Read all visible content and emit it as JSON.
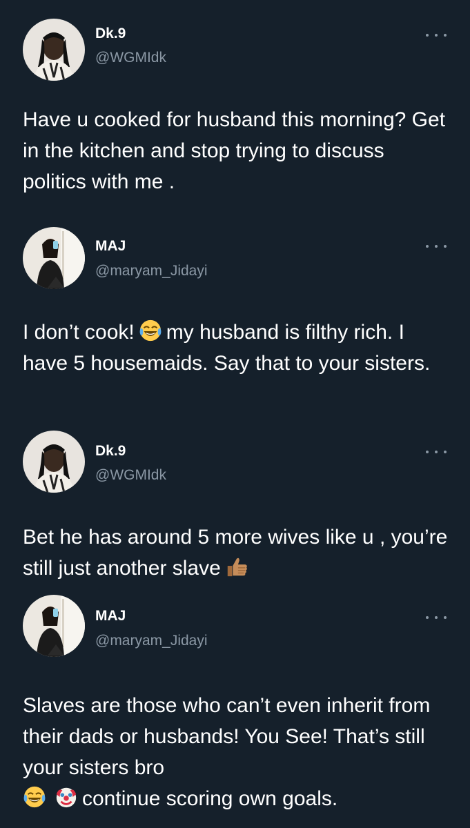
{
  "tweets": [
    {
      "name": "Dk.9",
      "handle": "@WGMIdk",
      "text": "Have u cooked for husband this morning? Get in the kitchen and stop trying to discuss politics with me ."
    },
    {
      "name": "MAJ",
      "handle": "@maryam_Jidayi",
      "text_part1": "I don’t cook!",
      "emoji1": "face-with-tears-of-joy-emoji",
      "text_part2": "my husband is filthy rich. I have 5 housemaids. Say that to your sisters."
    },
    {
      "name": "Dk.9",
      "handle": "@WGMIdk",
      "text": "Bet he has around 5 more wives like u , you’re still just another slave",
      "emoji1": "thumbs-up-emoji"
    },
    {
      "name": "MAJ",
      "handle": "@maryam_Jidayi",
      "text": "Slaves are those who can’t even inherit from their dads or husbands! You See! That’s still your sisters bro",
      "emoji1": "face-with-tears-of-joy-emoji",
      "emoji2": "clown-face-emoji",
      "text_end": "continue scoring own goals."
    }
  ],
  "colors": {
    "background": "#15202b",
    "text": "#ffffff",
    "secondary": "#8b98a5"
  }
}
